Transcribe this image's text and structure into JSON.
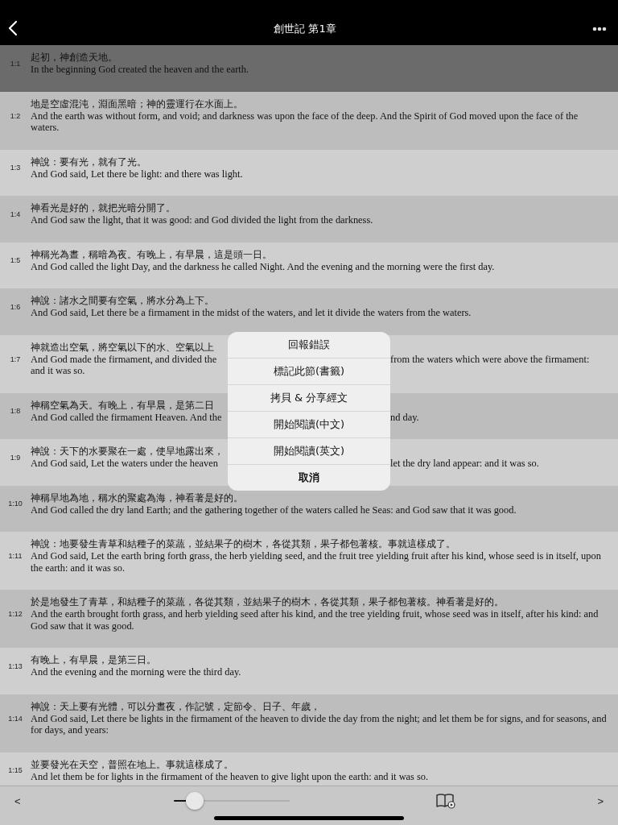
{
  "nav_bar": {
    "title": "創世記 第1章"
  },
  "verses": [
    {
      "kind": "full",
      "number": "1:1",
      "selected": true,
      "zh": "起初，神創造天地。",
      "en": "In the beginning God created the heaven and the earth."
    },
    {
      "kind": "full",
      "number": "1:2",
      "selected": false,
      "zh": "地是空虛混沌，淵面黑暗；神的靈運行在水面上。",
      "en": "And the earth was without form, and void; and darkness was upon the face of the deep. And the Spirit of God moved upon the face of the waters."
    },
    {
      "kind": "full",
      "number": "1:3",
      "selected": false,
      "zh": "神說：要有光，就有了光。",
      "en": "And God said, Let there be light: and there was light."
    },
    {
      "kind": "full",
      "number": "1:4",
      "selected": false,
      "zh": "神看光是好的，就把光暗分開了。",
      "en": "And God saw the light, that it was good: and God divided the light from the darkness."
    },
    {
      "kind": "full",
      "number": "1:5",
      "selected": false,
      "zh": "神稱光為晝，稱暗為夜。有晚上，有早晨，這是頭一日。",
      "en": "And God called the light Day, and the darkness he called Night. And the evening and the morning were the first day."
    },
    {
      "kind": "full",
      "number": "1:6",
      "selected": false,
      "zh": "神說：諸水之間要有空氣，將水分為上下。",
      "en": "And God said, Let there be a firmament in the midst of the waters, and let it divide the waters from the waters."
    },
    {
      "kind": "split",
      "number": "1:7",
      "selected": false,
      "zh_left": "神就造出空氣，將空氣以下的水、空氣以上",
      "en_lines": [
        {
          "left": "And God made the firmament, and divided the",
          "right": "from the waters which were above the firmament:"
        },
        {
          "left": "and it was so."
        }
      ]
    },
    {
      "kind": "split",
      "number": "1:8",
      "selected": false,
      "zh_left": "神稱空氣為天。有晚上，有早晨，是第二日",
      "en_lines": [
        {
          "left": "And God called the firmament Heaven. And the",
          "right": "nd day."
        }
      ]
    },
    {
      "kind": "split",
      "number": "1:9",
      "selected": false,
      "zh_left": "神說：天下的水要聚在一處，使旱地露出來，",
      "en_lines": [
        {
          "left": "And God said, Let the waters under the heaven",
          "right": "let the dry land appear: and it was so."
        }
      ]
    },
    {
      "kind": "full",
      "number": "1:10",
      "selected": false,
      "zh": "神稱旱地為地，稱水的聚處為海，神看著是好的。",
      "en": "And God called the dry land Earth; and the gathering together of the waters called he Seas: and God saw that it was good."
    },
    {
      "kind": "full",
      "number": "1:11",
      "selected": false,
      "zh": "神說：地要發生青草和結種子的菜蔬，並結果子的樹木，各從其類，果子都包著核。事就這樣成了。",
      "en": "And God said, Let the earth bring forth grass, the herb yielding seed, and the fruit tree yielding fruit after his kind, whose seed is in itself, upon the earth: and it was so."
    },
    {
      "kind": "full",
      "number": "1:12",
      "selected": false,
      "zh": "於是地發生了青草，和結種子的菜蔬，各從其類，並結果子的樹木，各從其類，果子都包著核。神看著是好的。",
      "en": "And the earth brought forth grass, and herb yielding seed after his kind, and the tree yielding fruit, whose seed was in itself, after his kind: and God saw that it was good."
    },
    {
      "kind": "full",
      "number": "1:13",
      "selected": false,
      "zh": "有晚上，有早晨，是第三日。",
      "en": "And the evening and the morning were the third day."
    },
    {
      "kind": "full",
      "number": "1:14",
      "selected": false,
      "zh": "神說：天上要有光體，可以分晝夜，作記號，定節令、日子、年歲，",
      "en": "And God said, Let there be lights in the firmament of the heaven to divide the day from the night; and let them be for signs, and for seasons, and for days, and years:"
    },
    {
      "kind": "full",
      "number": "1:15",
      "selected": false,
      "zh": "並要發光在天空，普照在地上。事就這樣成了。",
      "en": "And let them be for lights in the firmament of the heaven to give light upon the earth: and it was so."
    }
  ],
  "action_menu": [
    {
      "label": "回報錯誤",
      "kind": "action"
    },
    {
      "label": "標記此節(書籤)",
      "kind": "action"
    },
    {
      "label": "拷貝 & 分享經文",
      "kind": "action"
    },
    {
      "label": "開始閱讀(中文)",
      "kind": "action"
    },
    {
      "label": "開始閱讀(英文)",
      "kind": "action"
    },
    {
      "label": "取消",
      "kind": "cancel"
    }
  ],
  "toolbar": {
    "previous": "<",
    "next": ">",
    "font_size_slider": {
      "level": 0.18
    }
  }
}
